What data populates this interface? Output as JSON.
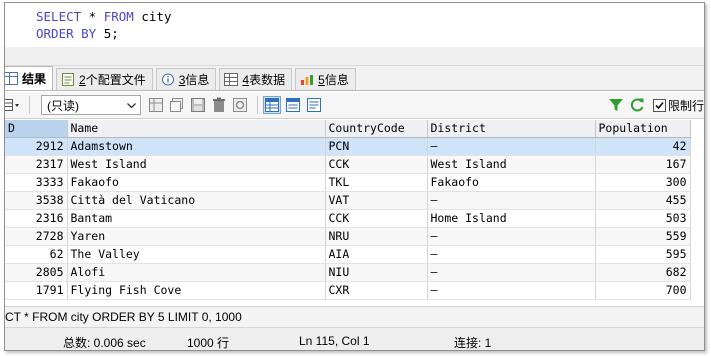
{
  "editor": {
    "line1": {
      "kw1": "SELECT",
      "rest1": " * ",
      "kw2": "FROM",
      "rest2": " city"
    },
    "line2": {
      "kw1": "ORDER BY",
      "rest1": " 5;"
    }
  },
  "tabs": [
    {
      "label": "结果",
      "icon": "table-result-icon"
    },
    {
      "num": "2",
      "label": " 个配置文件",
      "icon": "profile-icon"
    },
    {
      "num": "3",
      "label": " 信息",
      "icon": "info-icon"
    },
    {
      "num": "4",
      "label": " 表数据",
      "icon": "table-icon"
    },
    {
      "num": "5",
      "label": " 信息",
      "icon": "chart-info-icon"
    }
  ],
  "toolbar": {
    "mode_select": "(只读)",
    "limit_label": "限制行",
    "limit_checked": true
  },
  "grid": {
    "columns": [
      "D",
      "Name",
      "CountryCode",
      "District",
      "Population"
    ],
    "rows": [
      [
        "2912",
        "Adamstown",
        "PCN",
        "–",
        "42"
      ],
      [
        "2317",
        "West Island",
        "CCK",
        "West Island",
        "167"
      ],
      [
        "3333",
        "Fakaofo",
        "TKL",
        "Fakaofo",
        "300"
      ],
      [
        "3538",
        "Città del Vaticano",
        "VAT",
        "–",
        "455"
      ],
      [
        "2316",
        "Bantam",
        "CCK",
        "Home Island",
        "503"
      ],
      [
        "2728",
        "Yaren",
        "NRU",
        "–",
        "559"
      ],
      [
        "62",
        "The Valley",
        "AIA",
        "–",
        "595"
      ],
      [
        "2805",
        "Alofi",
        "NIU",
        "–",
        "682"
      ],
      [
        "1791",
        "Flying Fish Cove",
        "CXR",
        "–",
        "700"
      ]
    ]
  },
  "sql_bar": "CT * FROM city ORDER BY 5 LIMIT 0, 1000",
  "status": {
    "total": "总数: 0.006 sec",
    "rows": "1000 行",
    "position": "Ln 115, Col 1",
    "connection": "连接: 1"
  },
  "colors": {
    "selected_row": "#cfe3f9",
    "header_id": "#b9d3ef",
    "keyword": "#4848c8"
  }
}
